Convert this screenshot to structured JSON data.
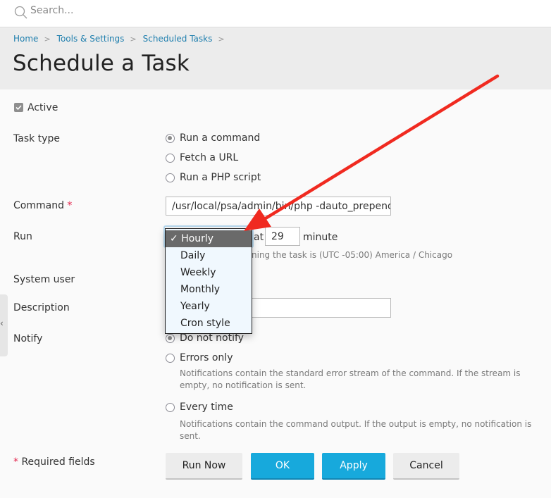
{
  "search": {
    "placeholder": "Search..."
  },
  "breadcrumb": [
    {
      "label": "Home"
    },
    {
      "label": "Tools & Settings"
    },
    {
      "label": "Scheduled Tasks"
    }
  ],
  "page_title": "Schedule a Task",
  "form": {
    "active": {
      "label": "Active",
      "checked": true
    },
    "task_type": {
      "label": "Task type",
      "options": [
        {
          "label": "Run a command",
          "selected": true
        },
        {
          "label": "Fetch a URL",
          "selected": false
        },
        {
          "label": "Run a PHP script",
          "selected": false
        }
      ]
    },
    "command": {
      "label": "Command",
      "required_mark": "*",
      "value": "/usr/local/psa/admin/bin/php -dauto_prepend"
    },
    "run": {
      "label": "Run",
      "at_label": "at",
      "minute_value": "29",
      "minute_label": "minute",
      "timezone_hint": "ning the task is (UTC -05:00) America / Chicago",
      "dropdown": {
        "selected": "Hourly",
        "check_glyph": "✓",
        "options": [
          "Hourly",
          "Daily",
          "Weekly",
          "Monthly",
          "Yearly",
          "Cron style"
        ]
      }
    },
    "system_user": {
      "label": "System user"
    },
    "description": {
      "label": "Description",
      "value": ""
    },
    "notify": {
      "label": "Notify",
      "options": [
        {
          "label": "Do not notify",
          "selected": true,
          "hint": ""
        },
        {
          "label": "Errors only",
          "selected": false,
          "hint": "Notifications contain the standard error stream of the command. If the stream is empty, no notification is sent."
        },
        {
          "label": "Every time",
          "selected": false,
          "hint": "Notifications contain the command output. If the output is empty, no notification is sent."
        }
      ]
    }
  },
  "required_note": {
    "mark": "*",
    "text": "Required fields"
  },
  "buttons": {
    "run_now": "Run Now",
    "ok": "OK",
    "apply": "Apply",
    "cancel": "Cancel"
  },
  "side_handle_glyph": "‹",
  "colors": {
    "accent": "#17a9dc",
    "link": "#1f7fae",
    "required": "#e3244c",
    "annotation_arrow": "#f02a20"
  }
}
